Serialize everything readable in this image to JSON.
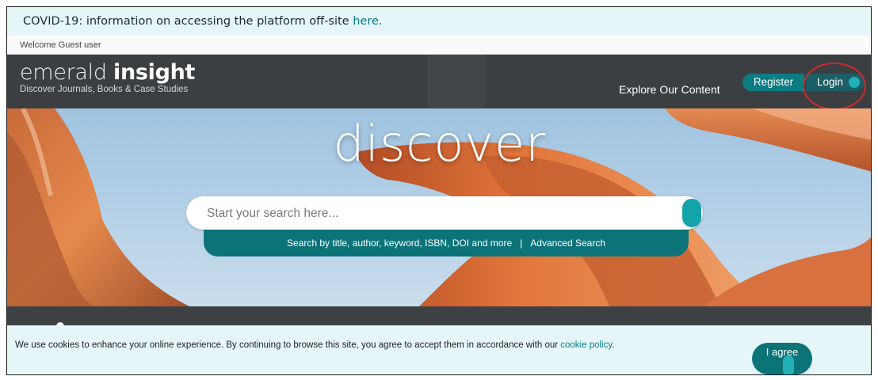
{
  "banner": {
    "text": "COVID-19: information on accessing the platform off-site ",
    "link": "here."
  },
  "welcome": "Welcome Guest user",
  "header": {
    "brand_light": "emerald ",
    "brand_bold": "insight",
    "tagline": "Discover Journals, Books & Case Studies",
    "explore": "Explore Our Content",
    "register": "Register",
    "login": "Login"
  },
  "hero": {
    "headline": "discover",
    "search_placeholder": "Start your search here...",
    "search_hint": "Search by title, author, keyword, ISBN, DOI and more",
    "separator": "|",
    "advanced": "Advanced Search"
  },
  "cookie": {
    "text": "We use cookies to enhance your online experience. By continuing to browse this site, you agree to accept them in accordance with our ",
    "link": "cookie policy",
    "end": ".",
    "agree": "I agree"
  },
  "colors": {
    "teal": "#0c7479",
    "header_bg": "#3b3f42",
    "banner_bg": "#e6f6f8",
    "annotation": "#d12a2a"
  }
}
